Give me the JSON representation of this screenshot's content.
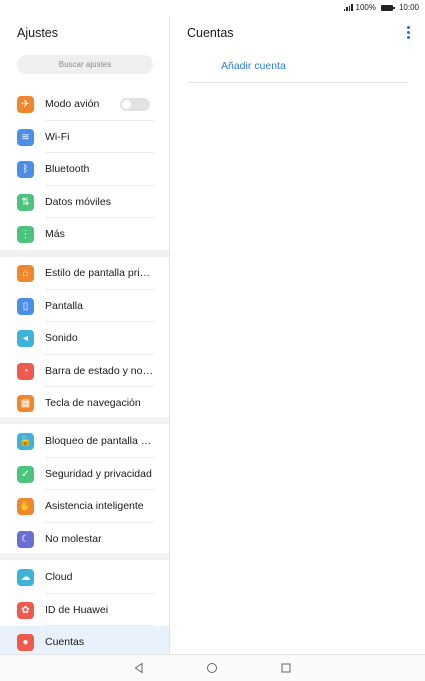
{
  "status": {
    "battery_text": "100%",
    "time": "10:00"
  },
  "left": {
    "title": "Ajustes",
    "search_placeholder": "Buscar ajustes",
    "groups": [
      [
        {
          "label": "Modo avión",
          "color": "#f0862e",
          "icon": "airplane-icon",
          "glyph": "✈",
          "toggle": true
        },
        {
          "label": "Wi-Fi",
          "color": "#4a8fe7",
          "icon": "wifi-icon",
          "glyph": "≋"
        },
        {
          "label": "Bluetooth",
          "color": "#4a8fe7",
          "icon": "bluetooth-icon",
          "glyph": "ᛒ"
        },
        {
          "label": "Datos móviles",
          "color": "#4cc47c",
          "icon": "mobile-data-icon",
          "glyph": "⇅"
        },
        {
          "label": "Más",
          "color": "#4cc47c",
          "icon": "more-icon",
          "glyph": "⋮"
        }
      ],
      [
        {
          "label": "Estilo de pantalla principal",
          "color": "#f0862e",
          "icon": "home-style-icon",
          "glyph": "⌂"
        },
        {
          "label": "Pantalla",
          "color": "#4a8fe7",
          "icon": "display-icon",
          "glyph": "▯"
        },
        {
          "label": "Sonido",
          "color": "#3fb2d9",
          "icon": "sound-icon",
          "glyph": "◂"
        },
        {
          "label": "Barra de estado y notificaciones",
          "color": "#ef5a4d",
          "icon": "notification-bell-icon",
          "glyph": "◔"
        },
        {
          "label": "Tecla de navegación",
          "color": "#f0862e",
          "icon": "navigation-key-icon",
          "glyph": "▦"
        }
      ],
      [
        {
          "label": "Bloqueo de pantalla y contraseñas",
          "color": "#3fb2d9",
          "icon": "lock-icon",
          "glyph": "🔒"
        },
        {
          "label": "Seguridad y privacidad",
          "color": "#4cc47c",
          "icon": "shield-icon",
          "glyph": "✓"
        },
        {
          "label": "Asistencia inteligente",
          "color": "#f0862e",
          "icon": "hand-icon",
          "glyph": "✋"
        },
        {
          "label": "No molestar",
          "color": "#6a6fd6",
          "icon": "moon-icon",
          "glyph": "☾"
        }
      ],
      [
        {
          "label": "Cloud",
          "color": "#3fb2d9",
          "icon": "cloud-icon",
          "glyph": "☁"
        },
        {
          "label": "ID de Huawei",
          "color": "#ef5a4d",
          "icon": "huawei-icon",
          "glyph": "✿"
        },
        {
          "label": "Cuentas",
          "color": "#ef5a4d",
          "icon": "account-icon",
          "glyph": "●",
          "selected": true
        }
      ]
    ]
  },
  "right": {
    "title": "Cuentas",
    "add_account": "Añadir cuenta"
  }
}
